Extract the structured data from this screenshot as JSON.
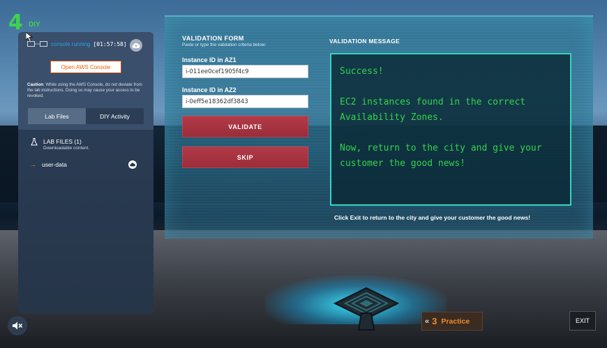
{
  "level": {
    "number": "4",
    "label": "DIY"
  },
  "console": {
    "status_text": "console running",
    "timer": "[01:57:58]",
    "open_button_label": "Open AWS Console",
    "caution_bold": "Caution",
    "caution_text": ": While using the AWS Console, do not deviate from the lab instructions. Doing so may cause your access to be revoked."
  },
  "tabs": [
    {
      "label": "Lab Files",
      "active": true
    },
    {
      "label": "DIY Activity",
      "active": false
    }
  ],
  "lab_files": {
    "title": "LAB FILES (1)",
    "subtitle": "Downloadable content.",
    "items": [
      {
        "name": "user-data"
      }
    ]
  },
  "validation_form": {
    "title": "VALIDATION FORM",
    "subtitle": "Paste or type the validation criteria below:",
    "fields": [
      {
        "label": "Instance ID in AZ1",
        "value": "i-011ee0cef1905f4c9"
      },
      {
        "label": "Instance ID in AZ2",
        "value": "i-0eff5e18362df3843"
      }
    ],
    "validate_label": "VALIDATE",
    "skip_label": "SKIP"
  },
  "validation_message": {
    "title": "VALIDATION MESSAGE",
    "lines": [
      "Success!",
      "EC2 instances found in the correct Availability Zones.",
      "Now, return to the city and give your customer the good news!"
    ]
  },
  "footer_note": "Click Exit to return to the city and give your customer the good news!",
  "controls": {
    "practice_number": "3",
    "practice_label": "Practice",
    "exit_label": "EXIT"
  },
  "colors": {
    "accent_green": "#3fd14f",
    "message_green": "#32d44a",
    "aws_orange": "#e8630a",
    "button_red": "#a8343f",
    "message_border": "#34d6c0"
  }
}
